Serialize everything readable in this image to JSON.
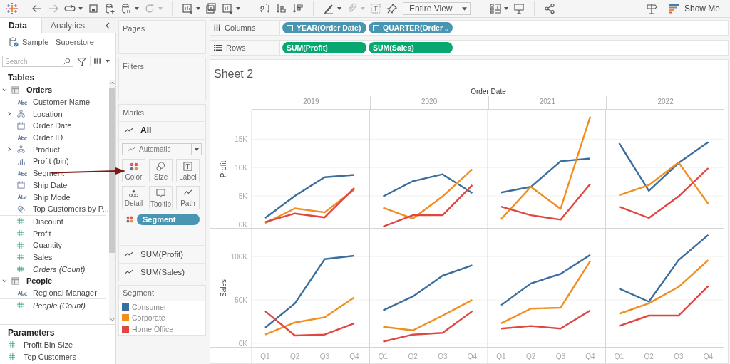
{
  "toolbar": {
    "fit": "Entire View",
    "show_me": "Show Me"
  },
  "data_pane": {
    "tabs": [
      {
        "label": "Data",
        "selected": true
      },
      {
        "label": "Analytics",
        "selected": false
      }
    ],
    "data_source": "Sample - Superstore",
    "search": {
      "placeholder": "Search"
    },
    "tables_heading": "Tables",
    "tables": [
      {
        "name": "Orders",
        "expanded": true,
        "fields": [
          {
            "name": "Customer Name",
            "kind": "text"
          },
          {
            "name": "Location",
            "kind": "hierarchy",
            "expanded": false
          },
          {
            "name": "Order Date",
            "kind": "date"
          },
          {
            "name": "Order ID",
            "kind": "text"
          },
          {
            "name": "Product",
            "kind": "hierarchy",
            "expanded": false
          },
          {
            "name": "Profit (bin)",
            "kind": "bin"
          },
          {
            "name": "Segment",
            "kind": "text"
          },
          {
            "name": "Ship Date",
            "kind": "date"
          },
          {
            "name": "Ship Mode",
            "kind": "text"
          },
          {
            "name": "Top Customers by P...",
            "kind": "set"
          },
          {
            "name": "Discount",
            "kind": "measure"
          },
          {
            "name": "Profit",
            "kind": "measure"
          },
          {
            "name": "Quantity",
            "kind": "measure"
          },
          {
            "name": "Sales",
            "kind": "measure"
          },
          {
            "name": "Orders (Count)",
            "kind": "count"
          }
        ]
      },
      {
        "name": "People",
        "expanded": true,
        "fields": [
          {
            "name": "Regional Manager",
            "kind": "text"
          },
          {
            "name": "People (Count)",
            "kind": "count"
          }
        ]
      }
    ],
    "parameters": {
      "heading": "Parameters",
      "items": [
        "Profit Bin Size",
        "Top Customers"
      ]
    }
  },
  "cards": {
    "pages": "Pages",
    "filters": "Filters",
    "marks": {
      "heading": "Marks",
      "all": "All",
      "mark_type": "Automatic",
      "buttons": [
        {
          "label": "Color",
          "kind": "color"
        },
        {
          "label": "Size",
          "kind": "size"
        },
        {
          "label": "Label",
          "kind": "label"
        },
        {
          "label": "Detail",
          "kind": "detail"
        },
        {
          "label": "Tooltip",
          "kind": "tooltip"
        },
        {
          "label": "Path",
          "kind": "path"
        }
      ],
      "pills": [
        {
          "label": "Segment",
          "kind": "color"
        }
      ],
      "measures": [
        "SUM(Profit)",
        "SUM(Sales)"
      ]
    },
    "legend": {
      "title": "Segment",
      "items": [
        {
          "label": "Consumer",
          "color": "#3a6e9e"
        },
        {
          "label": "Corporate",
          "color": "#f28e1e"
        },
        {
          "label": "Home Office",
          "color": "#e0453f"
        }
      ]
    }
  },
  "shelves": [
    {
      "label": "Columns",
      "kind": "columns",
      "pills": [
        {
          "label": "YEAR(Order Date)",
          "kind": "discrete",
          "expanded": true
        },
        {
          "label": "QUARTER(Order ..",
          "kind": "discrete",
          "expanded": false
        }
      ]
    },
    {
      "label": "Rows",
      "kind": "rows",
      "pills": [
        {
          "label": "SUM(Profit)",
          "kind": "continuous"
        },
        {
          "label": "SUM(Sales)",
          "kind": "continuous"
        }
      ]
    }
  ],
  "view": {
    "title": "Sheet 2",
    "column_header": "Order Date",
    "years": [
      "2019",
      "2020",
      "2021",
      "2022"
    ],
    "rows": [
      {
        "chart_data": {
          "type": "line",
          "grid": true,
          "ylabel": "Profit",
          "ylim": [
            -780,
            20200
          ],
          "yticks": [
            {
              "value": 0,
              "label": "0K"
            },
            {
              "value": 5000,
              "label": "5K"
            },
            {
              "value": 10000,
              "label": "10K"
            },
            {
              "value": 15000,
              "label": "15K"
            }
          ],
          "series": [
            {
              "color": "#3a6e9e",
              "values": [
                1100,
                5000,
                8300,
                8700,
                4900,
                7600,
                8800,
                5500,
                5600,
                6600,
                11100,
                11600,
                14300,
                5900,
                10800,
                14500
              ]
            },
            {
              "color": "#f28e1e",
              "values": [
                200,
                2800,
                2100,
                6100,
                2900,
                1000,
                4900,
                9700,
                900,
                6600,
                2700,
                19000,
                5100,
                6900,
                10900,
                3600
              ]
            },
            {
              "color": "#e0453f",
              "values": [
                400,
                1900,
                1200,
                6400,
                -400,
                1600,
                1600,
                6900,
                3100,
                1600,
                800,
                7100,
                3100,
                1100,
                4900,
                9900
              ]
            }
          ]
        }
      },
      {
        "chart_data": {
          "type": "line",
          "grid": true,
          "ylabel": "Sales",
          "ylim": [
            -5000,
            132200
          ],
          "categories": [
            "Q1",
            "Q2",
            "Q3",
            "Q4",
            "Q1",
            "Q2",
            "Q3",
            "Q4",
            "Q1",
            "Q2",
            "Q3",
            "Q4",
            "Q1",
            "Q2",
            "Q3",
            "Q4"
          ],
          "yticks": [
            {
              "value": 0,
              "label": "0K"
            },
            {
              "value": 50000,
              "label": "50K"
            },
            {
              "value": 100000,
              "label": "100K"
            }
          ],
          "series": [
            {
              "color": "#3a6e9e",
              "values": [
                18000,
                46000,
                97000,
                101000,
                38000,
                54000,
                78000,
                90000,
                44000,
                69000,
                80000,
                102000,
                63000,
                48000,
                96000,
                125000
              ]
            },
            {
              "color": "#f28e1e",
              "values": [
                10000,
                24000,
                30000,
                53000,
                19000,
                15000,
                32000,
                50000,
                23000,
                40000,
                41000,
                95000,
                34000,
                46000,
                65000,
                96000
              ]
            },
            {
              "color": "#e0453f",
              "values": [
                37000,
                9000,
                10000,
                23000,
                2000,
                10000,
                12000,
                37000,
                17000,
                20000,
                17000,
                38000,
                20000,
                32000,
                32000,
                66000
              ]
            }
          ]
        }
      }
    ]
  }
}
